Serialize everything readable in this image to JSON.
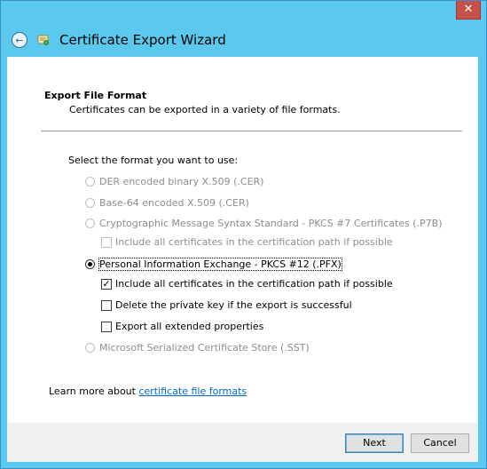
{
  "window": {
    "title": "Certificate Export Wizard",
    "close_glyph": "✕",
    "back_glyph": "←"
  },
  "header": {
    "section_title": "Export File Format",
    "section_subtitle": "Certificates can be exported in a variety of file formats."
  },
  "form": {
    "prompt": "Select the format you want to use:",
    "der_label": "DER encoded binary X.509 (.CER)",
    "base64_label": "Base-64 encoded X.509 (.CER)",
    "pkcs7_label": "Cryptographic Message Syntax Standard - PKCS #7 Certificates (.P7B)",
    "pkcs7_include_label": "Include all certificates in the certification path if possible",
    "pfx_label": "Personal Information Exchange - PKCS #12 (.PFX)",
    "pfx_include_label": "Include all certificates in the certification path if possible",
    "pfx_delete_label": "Delete the private key if the export is successful",
    "pfx_export_ext_label": "Export all extended properties",
    "sst_label": "Microsoft Serialized Certificate Store (.SST)",
    "selected": "pfx",
    "pfx_include_checked": true,
    "pfx_delete_checked": false,
    "pfx_export_ext_checked": false
  },
  "learn_more": {
    "prefix": "Learn more about ",
    "link_text": "certificate file formats"
  },
  "buttons": {
    "next": "Next",
    "cancel": "Cancel"
  },
  "colors": {
    "title_bar": "#5bc8ee",
    "close": "#c7504a",
    "link": "#0066cc"
  }
}
